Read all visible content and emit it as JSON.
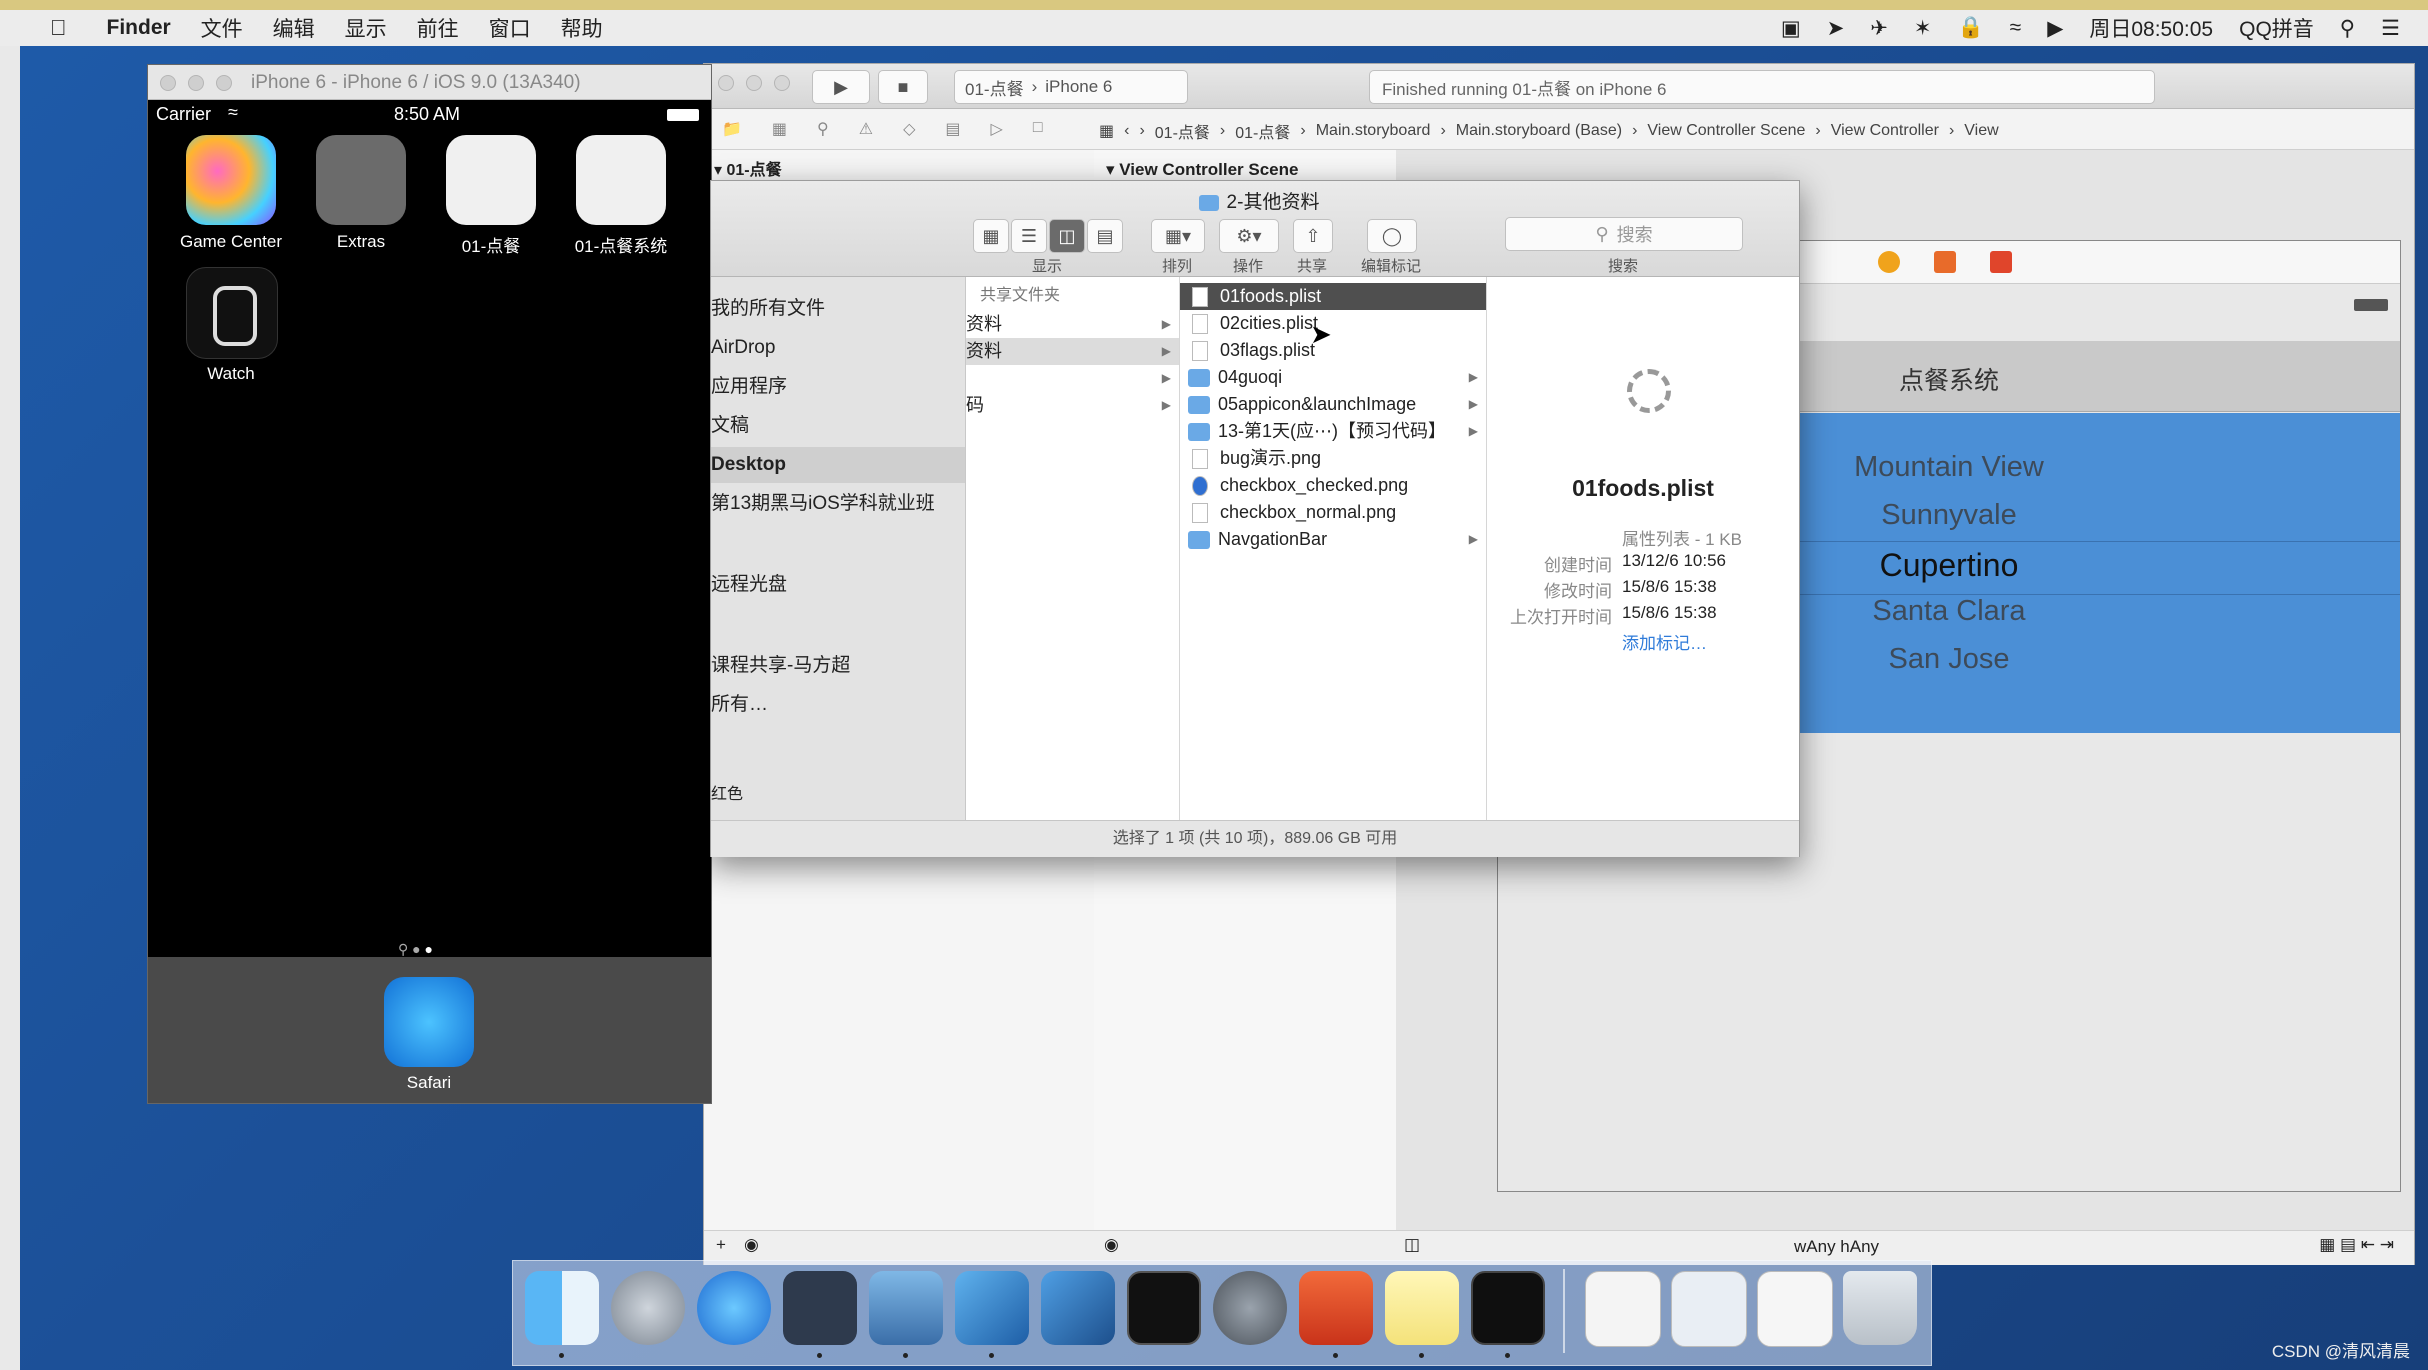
{
  "menubar": {
    "apple": "",
    "app": "Finder",
    "items": [
      "文件",
      "编辑",
      "显示",
      "前往",
      "窗口",
      "帮助"
    ],
    "clock": "周日08:50:05",
    "input_method": "QQ拼音"
  },
  "simulator": {
    "title": "iPhone 6 - iPhone 6 / iOS 9.0 (13A340)",
    "carrier": "Carrier",
    "time": "8:50 AM",
    "apps": [
      {
        "label": "Game Center",
        "icon": "game-center-icon"
      },
      {
        "label": "Extras",
        "icon": "folder-icon"
      },
      {
        "label": "01-点餐",
        "icon": "blank-app-icon"
      },
      {
        "label": "01-点餐系统",
        "icon": "blank-app-icon"
      },
      {
        "label": "Watch",
        "icon": "watch-icon"
      }
    ],
    "dock_app": "Safari"
  },
  "xcode": {
    "scheme": "01-点餐",
    "device": "iPhone 6",
    "status": "Finished running 01-点餐 on iPhone 6",
    "jumpbar": [
      "01-点餐",
      "01-点餐",
      "Main.storyboard",
      "Main.storyboard (Base)",
      "View Controller Scene",
      "View Controller",
      "View"
    ],
    "navigator_root": "01-点餐",
    "outline_root": "View Controller Scene",
    "size_class": "wAny hAny",
    "nav_title": "点餐系统",
    "picker": [
      "Mountain View",
      "Sunnyvale",
      "Cupertino",
      "Santa Clara",
      "San Jose"
    ],
    "selected_picker": "Cupertino"
  },
  "finder": {
    "title": "2-其他资料",
    "toolbar_labels": [
      "显示",
      "排列",
      "操作",
      "共享",
      "编辑标记",
      "搜索"
    ],
    "search_placeholder": "搜索",
    "sidebar_header": "共享文件夹",
    "sidebar": [
      "我的所有文件",
      "AirDrop",
      "应用程序",
      "文稿",
      "Desktop",
      "第13期黑马iOS学科就业班",
      "远程光盘",
      "课程共享-马方超",
      "所有…",
      "红色"
    ],
    "sidebar_selected": "Desktop",
    "col1": [
      "资料",
      "资料",
      "",
      "码"
    ],
    "col2": [
      {
        "name": "01foods.plist",
        "type": "doc",
        "selected": true
      },
      {
        "name": "02cities.plist",
        "type": "doc"
      },
      {
        "name": "03flags.plist",
        "type": "doc"
      },
      {
        "name": "04guoqi",
        "type": "folder"
      },
      {
        "name": "05appicon&launchImage",
        "type": "folder"
      },
      {
        "name": "13-第1天(应⋯)【预习代码】",
        "type": "folder"
      },
      {
        "name": "bug演示.png",
        "type": "doc"
      },
      {
        "name": "checkbox_checked.png",
        "type": "doc"
      },
      {
        "name": "checkbox_normal.png",
        "type": "doc"
      },
      {
        "name": "NavgationBar",
        "type": "folder"
      }
    ],
    "preview": {
      "name": "01foods.plist",
      "kind": "属性列表 - 1 KB",
      "created_label": "创建时间",
      "created": "13/12/6 10:56",
      "modified_label": "修改时间",
      "modified": "15/8/6 15:38",
      "opened_label": "上次打开时间",
      "opened": "15/8/6 15:38",
      "add_tag": "添加标记…"
    },
    "status": "选择了 1 项 (共 10 项)，889.06 GB 可用"
  },
  "watermark": "CSDN @清风清晨"
}
